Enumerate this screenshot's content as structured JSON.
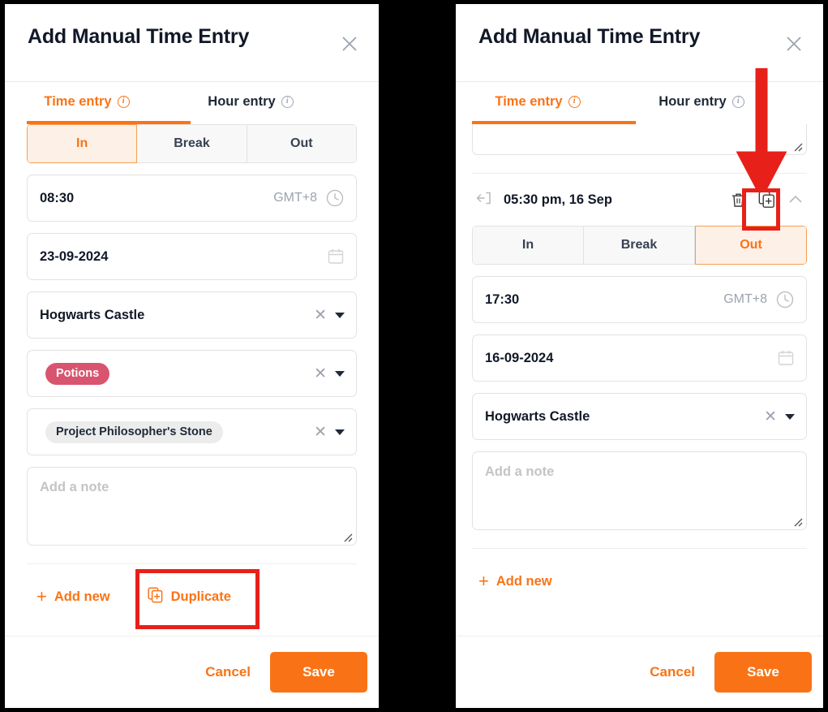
{
  "dialog": {
    "title": "Add Manual Time Entry",
    "close_icon": "close-icon"
  },
  "tabs": {
    "time_entry": "Time entry",
    "hour_entry": "Hour entry",
    "active": "Time entry"
  },
  "segments": {
    "in": "In",
    "break": "Break",
    "out": "Out"
  },
  "left_panel": {
    "active_segment": "In",
    "time_value": "08:30",
    "timezone": "GMT+8",
    "date_value": "23-09-2024",
    "location_value": "Hogwarts Castle",
    "tag_chip": "Potions",
    "project_chip": "Project Philosopher's Stone",
    "note_placeholder": "Add a note",
    "add_new_label": "Add new",
    "duplicate_label": "Duplicate",
    "cancel_label": "Cancel",
    "save_label": "Save"
  },
  "right_panel": {
    "entry_row_label": "05:30 pm, 16 Sep",
    "active_segment": "Out",
    "time_value": "17:30",
    "timezone": "GMT+8",
    "date_value": "16-09-2024",
    "location_value": "Hogwarts Castle",
    "note_placeholder": "Add a note",
    "add_new_label": "Add new",
    "cancel_label": "Cancel",
    "save_label": "Save"
  },
  "icons": {
    "clock": "clock-icon",
    "calendar": "calendar-icon",
    "clear": "✕",
    "trash": "trash-icon",
    "duplicate": "duplicate-icon",
    "chevron_up": "chevron-up-icon",
    "exit_arrow": "arrow-left-bracket-icon",
    "plus": "+"
  },
  "colors": {
    "accent": "#f97316",
    "accent_soft": "#fdf0e6",
    "annotation": "#e8201a",
    "tag_chip": "#d9546f",
    "project_chip": "#ececec",
    "text": "#111827",
    "muted": "#9ca3af",
    "border": "#e2e2e2"
  },
  "annotations": {
    "duplicate_button_highlight": "red-rectangle",
    "duplicate_icon_highlight": "red-rectangle",
    "pointer": "red-down-arrow"
  }
}
